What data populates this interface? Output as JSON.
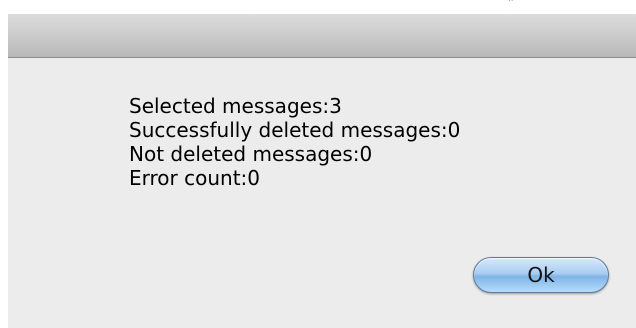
{
  "dialog": {
    "messages": [
      "Selected messages:3",
      "Successfully deleted messages:0",
      "Not deleted messages:0",
      "Error count:0"
    ],
    "ok_label": "Ok"
  },
  "colors": {
    "button_accent": "#7fb4e8",
    "dialog_background": "#ececec",
    "title_bar": "#c9c9c9"
  }
}
